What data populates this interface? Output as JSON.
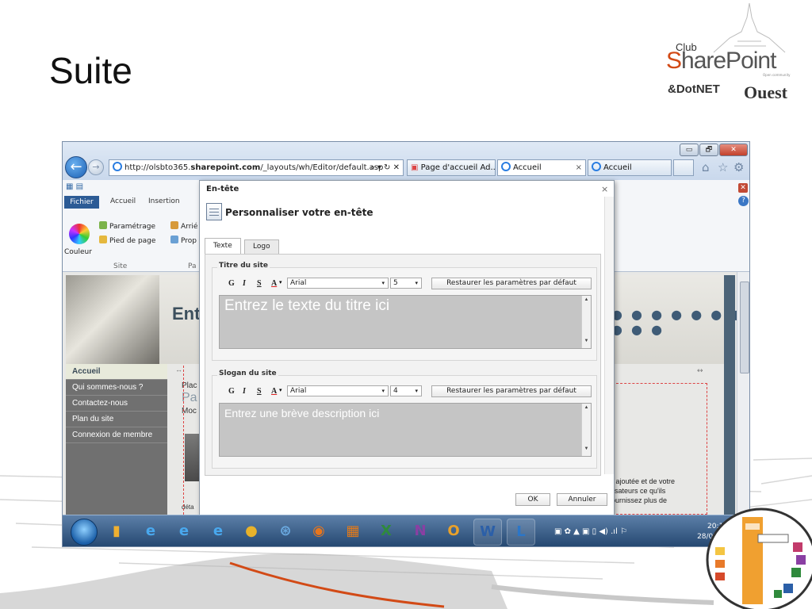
{
  "slide": {
    "title": "Suite",
    "logo": {
      "club": "Club",
      "sharepoint": "SharePoint",
      "dotnet": "&DotNET",
      "ouest": "Ouest",
      "tagline": "Open community"
    }
  },
  "browser": {
    "url_prefix": "http://olsbto365.",
    "url_domain": "sharepoint.com",
    "url_path": "/_layouts/wh/Editor/default.asp",
    "url_controls": "⌕ ▾ ↻ ✕",
    "tabs": [
      {
        "label": "Page d'accueil Ad..."
      },
      {
        "label": "Accueil",
        "close": "×"
      },
      {
        "label": "Accueil"
      }
    ],
    "window_controls": {
      "minimize": "▭",
      "restore": "🗗",
      "close": "✕"
    },
    "toolbar_icons": [
      "home-icon",
      "star-icon",
      "gear-icon"
    ],
    "toolbar_glyphs": {
      "home": "⌂",
      "star": "☆",
      "gear": "⚙"
    }
  },
  "ribbon": {
    "tabs": [
      "Fichier",
      "Accueil",
      "Insertion"
    ],
    "items": {
      "couleur": "Couleur",
      "parametrage": "Paramétrage",
      "pied": "Pied de page",
      "arriere": "Arrié",
      "prop": "Prop"
    },
    "groups": {
      "site": "Site",
      "page": "Pa"
    },
    "close_glyph": "✕",
    "help_glyph": "?"
  },
  "site": {
    "title": "Ent",
    "dots": "● ● ● ● ● ● ● ● ● ●",
    "nav": [
      "Accueil",
      "Qui sommes-nous ?",
      "Contactez-nous",
      "Plan du site",
      "Connexion de membre"
    ],
    "content_left": {
      "line1": "Plac",
      "line2": "Pa",
      "line3": "Moc",
      "footer": "déta"
    },
    "anchor_glyph": "↔",
    "right_text": [
      "r ajoutée et de votre",
      "lisateurs ce qu'ils",
      "ournissez plus de"
    ]
  },
  "dialog": {
    "title": "En-tête",
    "close_glyph": "×",
    "heading": "Personnaliser votre en-tête",
    "tabs": [
      "Texte",
      "Logo"
    ],
    "sections": [
      {
        "label": "Titre du site",
        "format_buttons": [
          "G",
          "I",
          "S",
          "A"
        ],
        "font": "Arial",
        "size": "5",
        "restore": "Restaurer les paramètres par défaut",
        "placeholder": "Entrez le texte du titre ici"
      },
      {
        "label": "Slogan du site",
        "format_buttons": [
          "G",
          "I",
          "S",
          "A"
        ],
        "font": "Arial",
        "size": "4",
        "restore": "Restaurer les paramètres par défaut",
        "placeholder": "Entrez une brève description ici"
      }
    ],
    "ok": "OK",
    "cancel": "Annuler"
  },
  "taskbar": {
    "apps": [
      {
        "icon": "folder-icon",
        "glyph": "▮",
        "color": "#f0b030"
      },
      {
        "icon": "ie-icon",
        "glyph": "e",
        "color": "#49a8ee"
      },
      {
        "icon": "ie-icon",
        "glyph": "e",
        "color": "#49a8ee"
      },
      {
        "icon": "ie-icon",
        "glyph": "e",
        "color": "#49a8ee"
      },
      {
        "icon": "chrome-icon",
        "glyph": "●",
        "color": "#e8b22a"
      },
      {
        "icon": "safari-icon",
        "glyph": "⊛",
        "color": "#6aa9e0"
      },
      {
        "icon": "firefox-icon",
        "glyph": "◉",
        "color": "#e8761c"
      },
      {
        "icon": "sharepoint-designer-icon",
        "glyph": "▦",
        "color": "#e27a1a"
      },
      {
        "icon": "excel-icon",
        "glyph": "X",
        "color": "#2f8a3c"
      },
      {
        "icon": "onenote-icon",
        "glyph": "N",
        "color": "#8a3fa3"
      },
      {
        "icon": "outlook-icon",
        "glyph": "O",
        "color": "#e9a12a"
      },
      {
        "icon": "word-icon",
        "glyph": "W",
        "color": "#2b5fa8"
      },
      {
        "icon": "lync-icon",
        "glyph": "L",
        "color": "#2b76c8"
      }
    ],
    "tray": "▣ ✿ ▲ ▣ ▯ ◀) .ıl ⚐",
    "time": "20:11",
    "date": "28/03/2012"
  },
  "colors": {
    "accent_orange": "#d24a16",
    "ribbon_blue": "#2c5b95",
    "nav_grey": "#707070",
    "slate_blue": "#4c6478"
  }
}
